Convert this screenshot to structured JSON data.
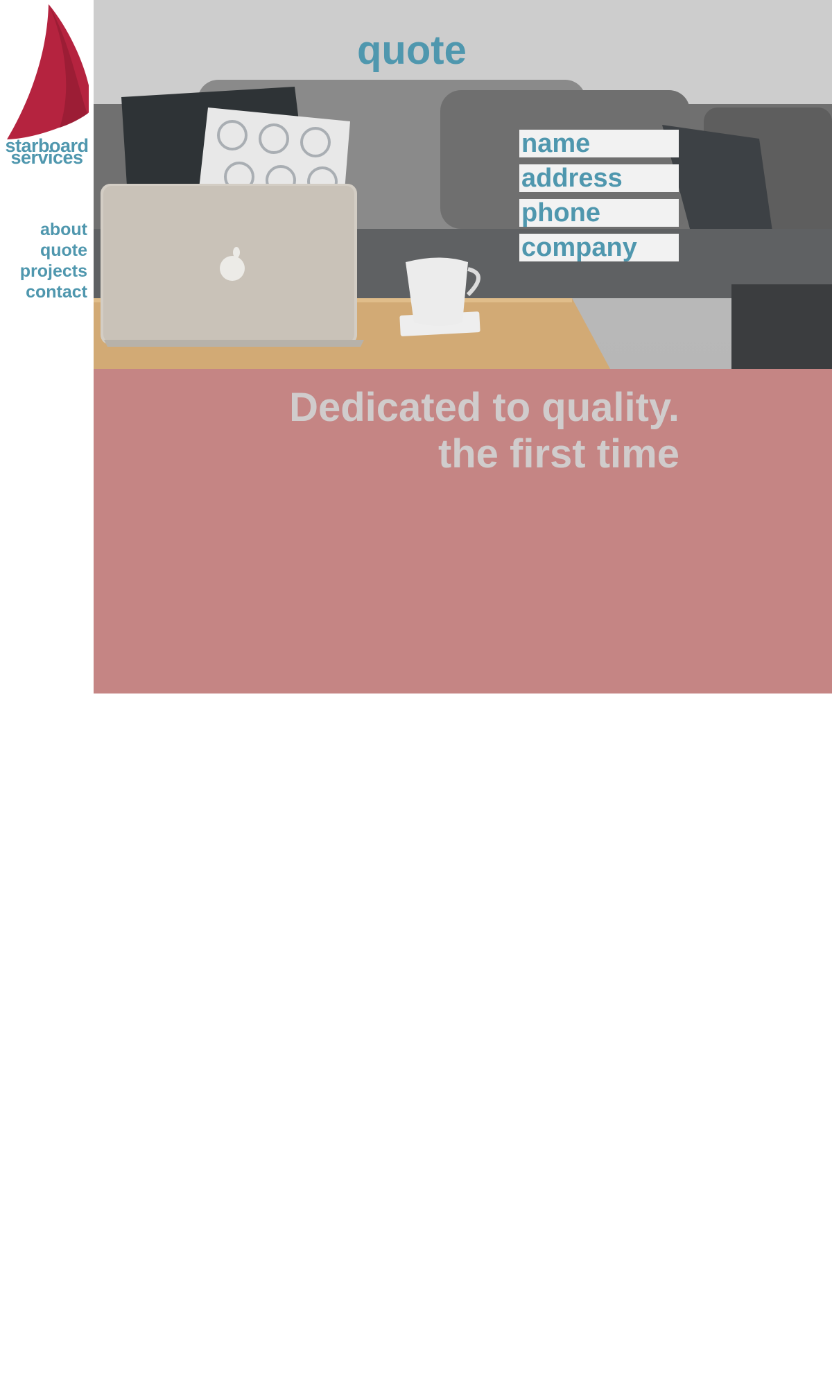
{
  "brand": {
    "line1": "starboard",
    "line2": "services",
    "logo_icon": "sail-icon",
    "sail_color": "#b5233f"
  },
  "nav": {
    "items": [
      {
        "label": "about"
      },
      {
        "label": "quote"
      },
      {
        "label": "projects"
      },
      {
        "label": "contact"
      }
    ]
  },
  "hero": {
    "title": "quote",
    "form": {
      "name_placeholder": "name",
      "address_placeholder": "address",
      "phone_placeholder": "phone",
      "company_placeholder": "company"
    }
  },
  "band": {
    "line1": "Dedicated to quality.",
    "line2": "the first time"
  },
  "colors": {
    "accent": "#4f97ae",
    "band": "#c58584",
    "tagline": "#d0cccc",
    "field_bg": "#f2f2f2"
  }
}
